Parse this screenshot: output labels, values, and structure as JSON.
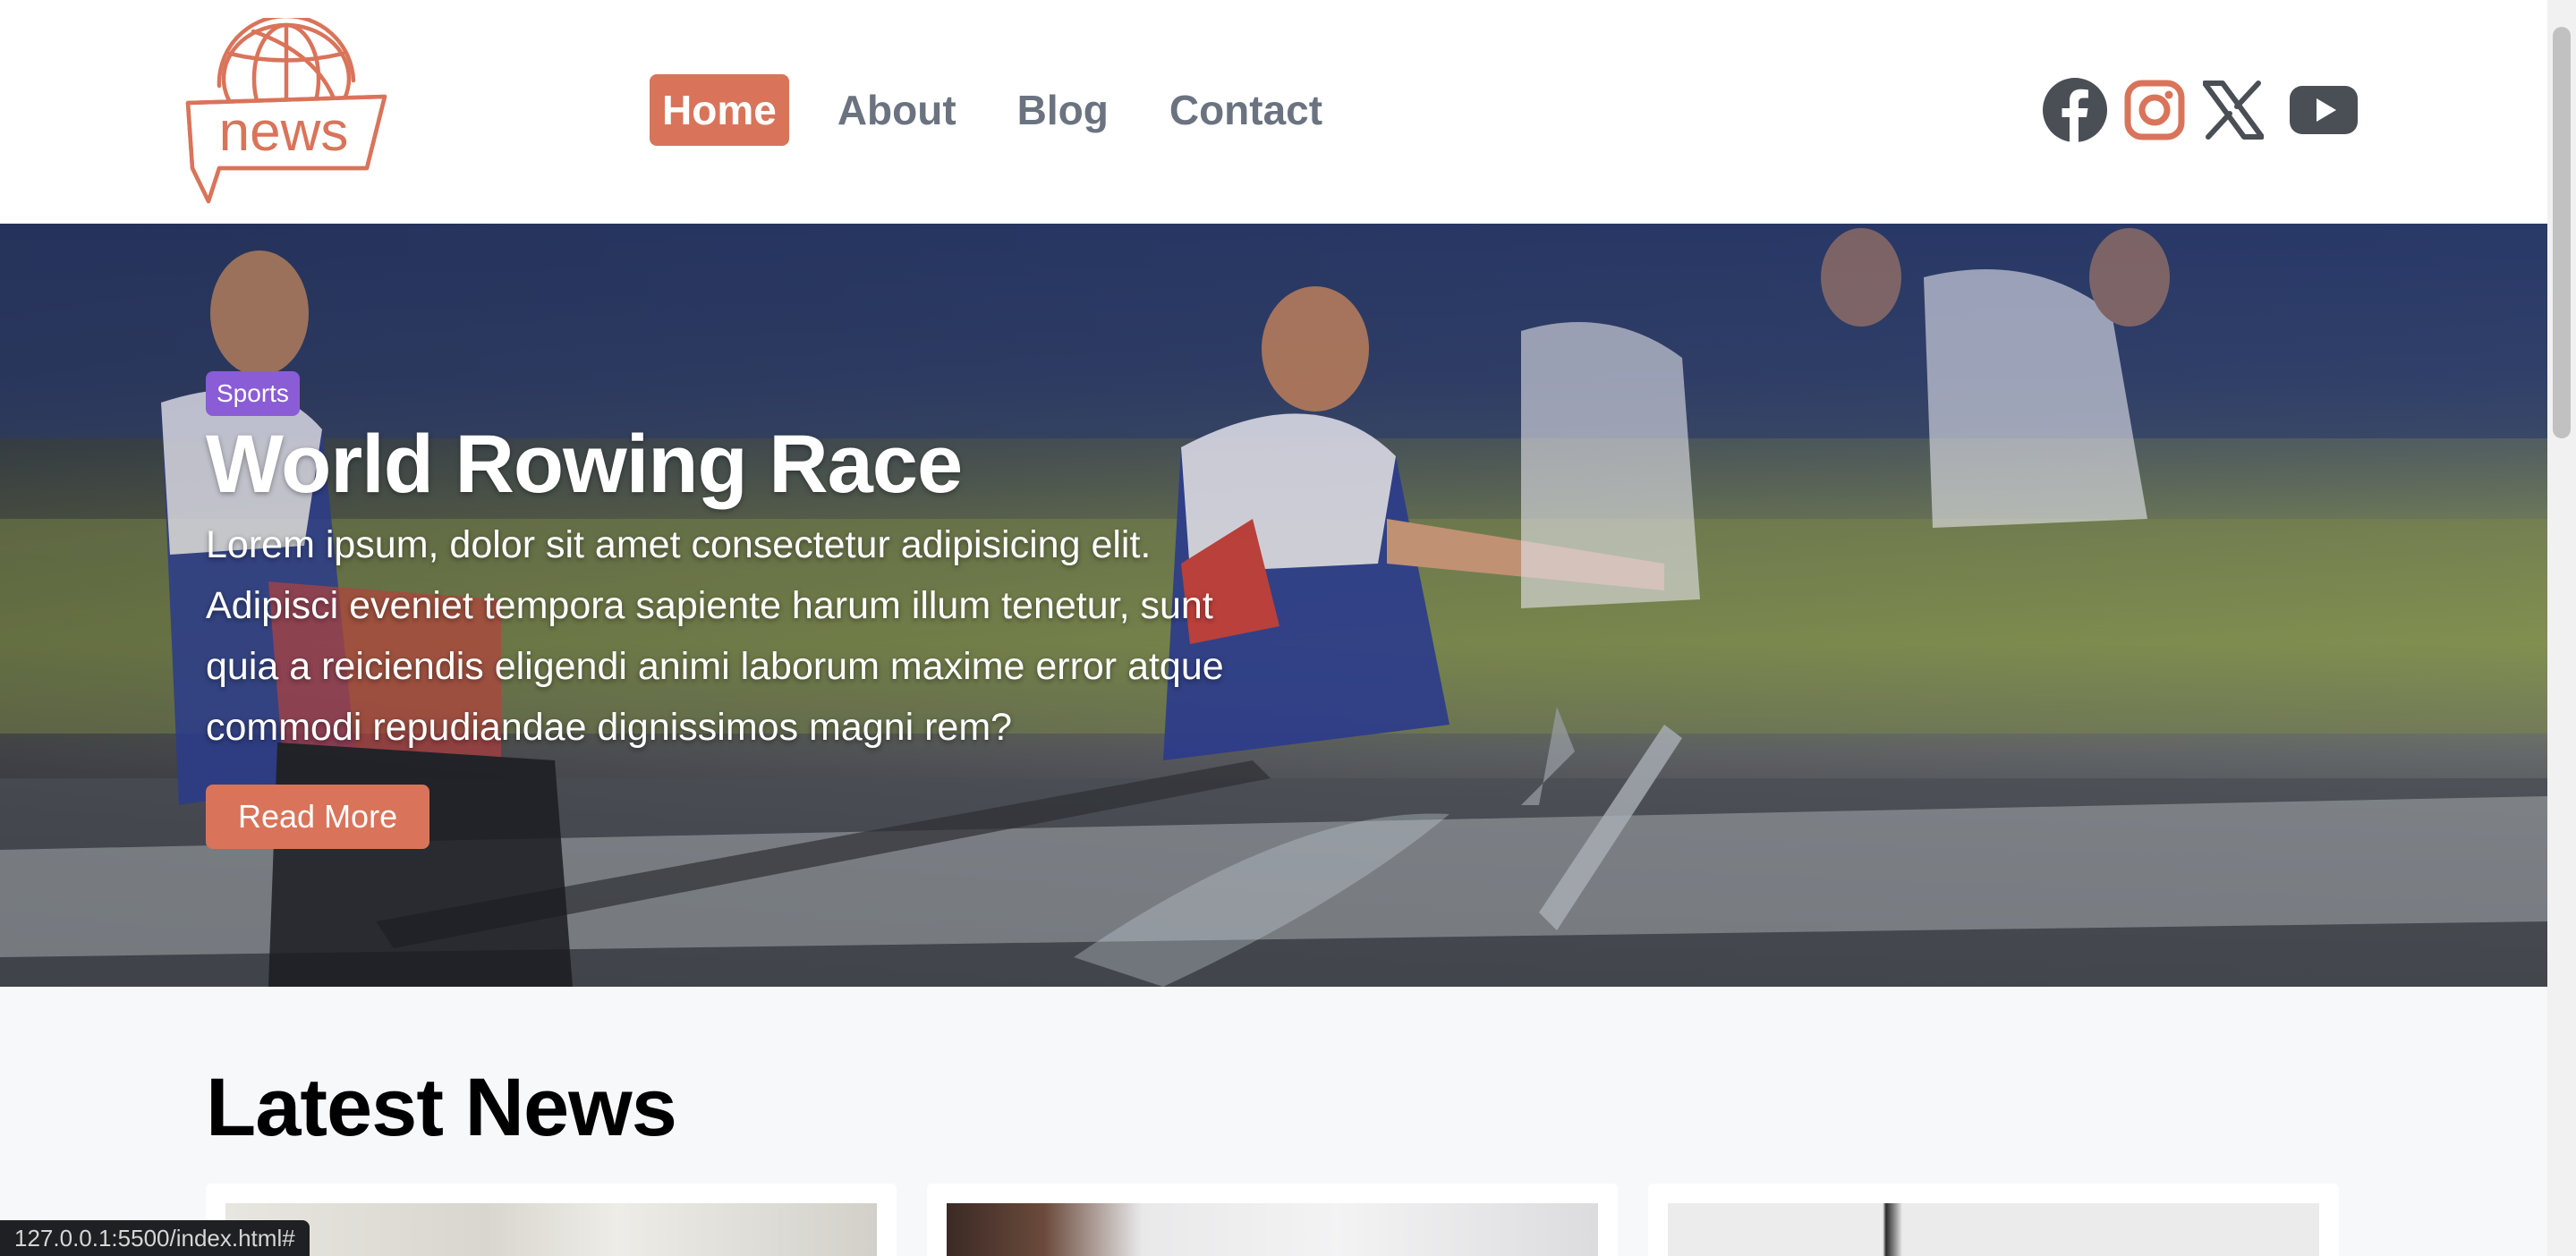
{
  "logo": {
    "text": "news",
    "color": "#d9745a"
  },
  "nav": {
    "items": [
      {
        "label": "Home",
        "active": true
      },
      {
        "label": "About",
        "active": false
      },
      {
        "label": "Blog",
        "active": false
      },
      {
        "label": "Contact",
        "active": false
      }
    ]
  },
  "social": [
    {
      "name": "facebook-icon",
      "color": "#4a4f56"
    },
    {
      "name": "instagram-icon",
      "color": "#d9745a"
    },
    {
      "name": "x-icon",
      "color": "#4a4f56"
    },
    {
      "name": "youtube-icon",
      "color": "#4a4f56"
    }
  ],
  "hero": {
    "badge": "Sports",
    "title": "World Rowing Race",
    "text": "Lorem ipsum, dolor sit amet consectetur adipisicing elit. Adipisci eveniet tempora sapiente harum illum tenetur, sunt quia a reiciendis eligendi animi laborum maxime error atque commodi repudiandae dignissimos magni rem?",
    "button": "Read More",
    "badge_color": "#8a5cd6",
    "button_color": "#d9745a"
  },
  "latest": {
    "title": "Latest News"
  },
  "status": {
    "url": "127.0.0.1:5500/index.html#"
  }
}
